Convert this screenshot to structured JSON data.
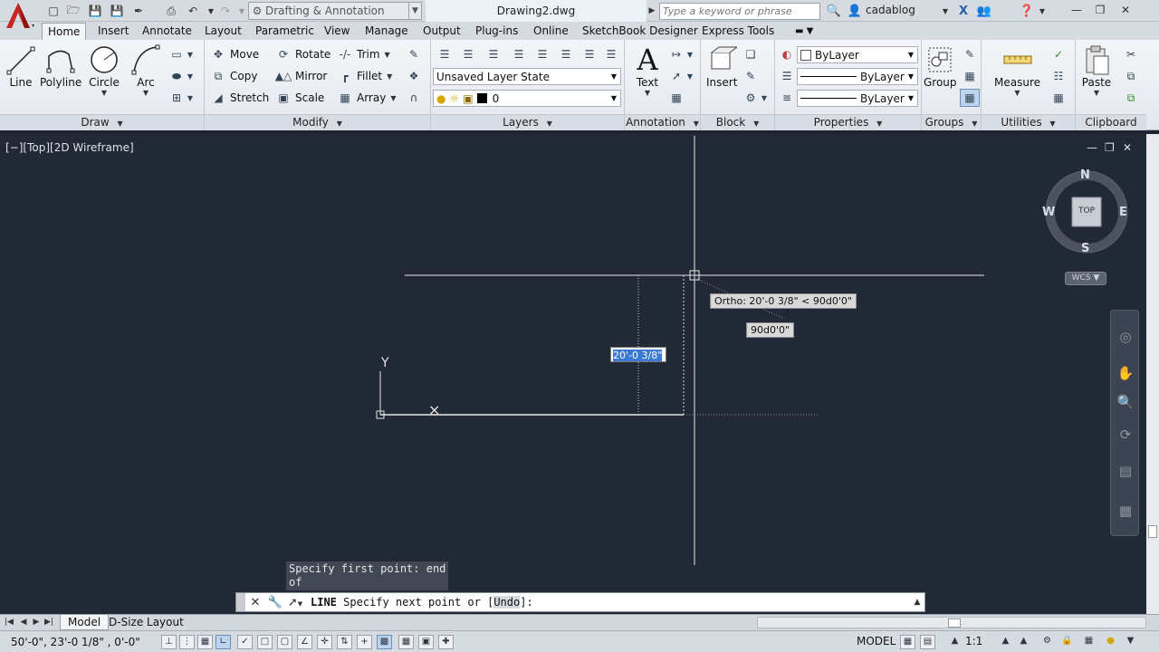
{
  "title_bar": {
    "workspace": "Drafting & Annotation",
    "document_title": "Drawing2.dwg",
    "search_placeholder": "Type a keyword or phrase",
    "user": "cadablog"
  },
  "ribbon_tabs": [
    "Home",
    "Insert",
    "Annotate",
    "Layout",
    "Parametric",
    "View",
    "Manage",
    "Output",
    "Plug-ins",
    "Online",
    "SketchBook Designer",
    "Express Tools"
  ],
  "draw_panel": {
    "title": "Draw",
    "line": "Line",
    "polyline": "Polyline",
    "circle": "Circle",
    "arc": "Arc"
  },
  "modify_panel": {
    "title": "Modify",
    "move": "Move",
    "rotate": "Rotate",
    "trim": "Trim",
    "copy": "Copy",
    "mirror": "Mirror",
    "fillet": "Fillet",
    "stretch": "Stretch",
    "scale": "Scale",
    "array": "Array"
  },
  "layers_panel": {
    "title": "Layers",
    "layer_state": "Unsaved Layer State",
    "current_layer": "0"
  },
  "annotation_panel": {
    "title": "Annotation",
    "text": "Text"
  },
  "block_panel": {
    "title": "Block",
    "insert": "Insert"
  },
  "properties_panel": {
    "title": "Properties",
    "color": "ByLayer",
    "lineweight": "ByLayer",
    "linetype": "ByLayer"
  },
  "groups_panel": {
    "title": "Groups",
    "group": "Group"
  },
  "utilities_panel": {
    "title": "Utilities",
    "measure": "Measure"
  },
  "clipboard_panel": {
    "title": "Clipboard",
    "paste": "Paste"
  },
  "viewport": {
    "label": "[−][Top][2D Wireframe]",
    "viewcube": {
      "north": "N",
      "south": "S",
      "east": "E",
      "west": "W",
      "face": "TOP"
    },
    "ucs_button": "WCS",
    "ortho_tooltip": "Ortho: 20'-0 3/8\" < 90d0'0\"",
    "angle_tooltip": "90d0'0\"",
    "distance_input": "20'-0 3/8\""
  },
  "command_line": {
    "history": [
      "Specify first point: end",
      "of"
    ],
    "command": "LINE",
    "prompt": "Specify next point or [",
    "option": "Undo",
    "prompt_end": "]:"
  },
  "layout_tabs": [
    "Model",
    "D-Size Layout"
  ],
  "status_bar": {
    "coordinates": "50'-0\",   23'-0 1/8\"  , 0'-0\"",
    "space": "MODEL",
    "scale": "1:1"
  }
}
